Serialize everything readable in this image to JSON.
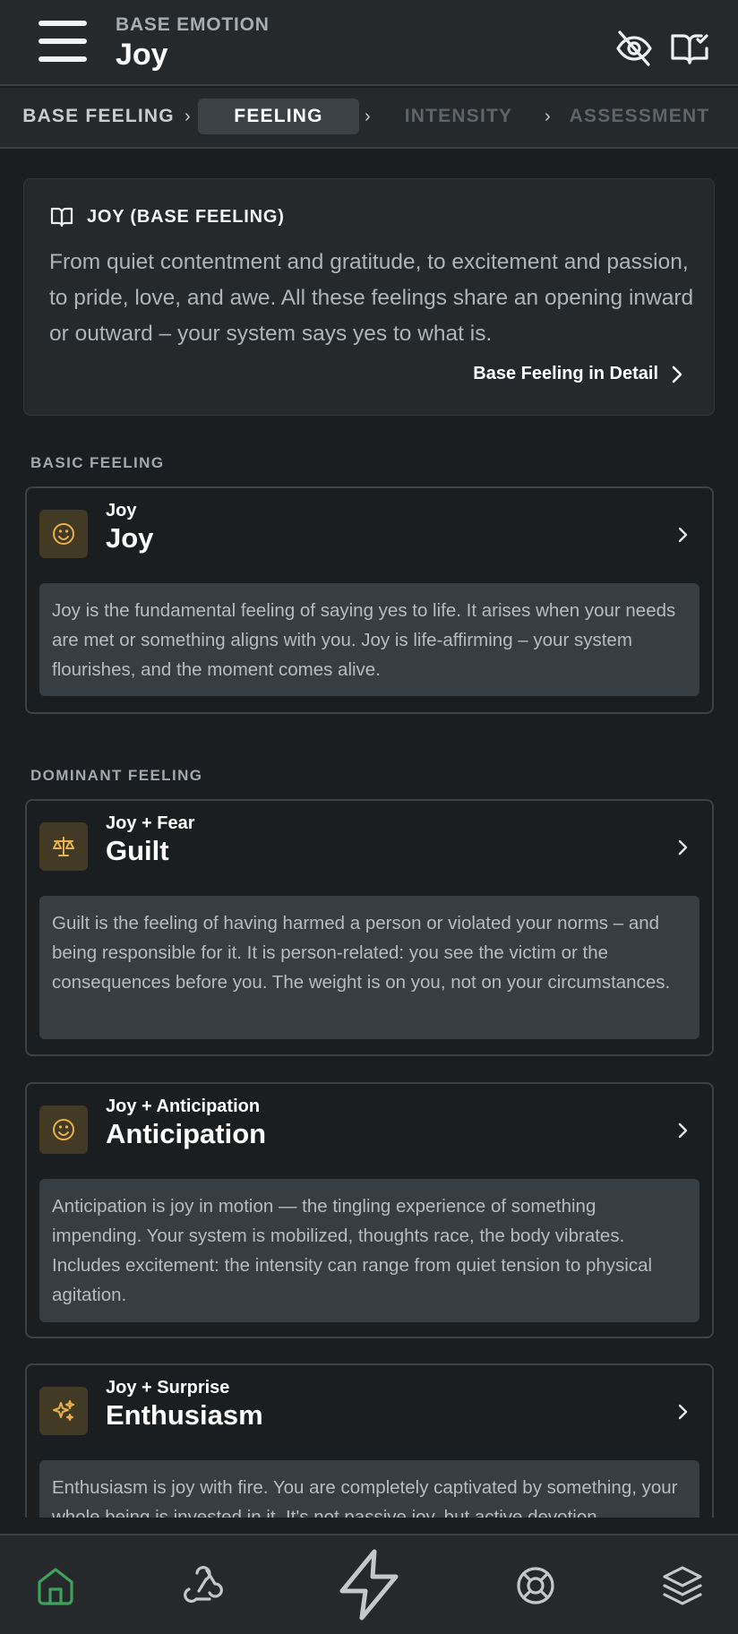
{
  "header": {
    "kicker": "BASE EMOTION",
    "title": "Joy"
  },
  "stepper": {
    "steps": [
      {
        "label": "BASE FEELING",
        "state": "done"
      },
      {
        "label": "FEELING",
        "state": "active"
      },
      {
        "label": "INTENSITY",
        "state": "todo"
      },
      {
        "label": "ASSESSMENT",
        "state": "todo"
      }
    ]
  },
  "intro": {
    "title": "JOY (BASE FEELING)",
    "text": "From quiet contentment and gratitude, to excitement and passion, to pride, love, and awe. All these feelings share an opening inward or outward – your system says yes to what is.",
    "link": "Base Feeling in Detail"
  },
  "sections": {
    "basic": "BASIC FEELING",
    "dominant": "DOMINANT FEELING"
  },
  "cards": [
    {
      "icon": "smiley-icon",
      "sub": "Joy",
      "title": "Joy",
      "desc": "Joy is the fundamental feeling of saying yes to life. It arises when your needs are met or something aligns with you. Joy is life-affirming – your system flourishes, and the moment comes alive."
    },
    {
      "icon": "scale-icon",
      "sub": "Joy + Fear",
      "title": "Guilt",
      "desc": "Guilt is the feeling of having harmed a person or violated your norms – and being responsible for it. It is person-related: you see the victim or the consequences before you. The weight is on you, not on your circumstances."
    },
    {
      "icon": "smiley-icon",
      "sub": "Joy + Anticipation",
      "title": "Anticipation",
      "desc": "Anticipation is joy in motion — the tingling experience of something impending. Your system is mobilized, thoughts race, the body vibrates. Includes excitement: the intensity can range from quiet tension to physical agitation."
    },
    {
      "icon": "sparkles-icon",
      "sub": "Joy + Surprise",
      "title": "Enthusiasm",
      "desc": "Enthusiasm is joy with fire. You are completely captivated by something, your whole being is invested in it. It's not passive joy, but active devotion."
    }
  ],
  "colors": {
    "accent": "#e7b24a",
    "nav_active": "#3fa15a",
    "background": "#1b1e20"
  }
}
